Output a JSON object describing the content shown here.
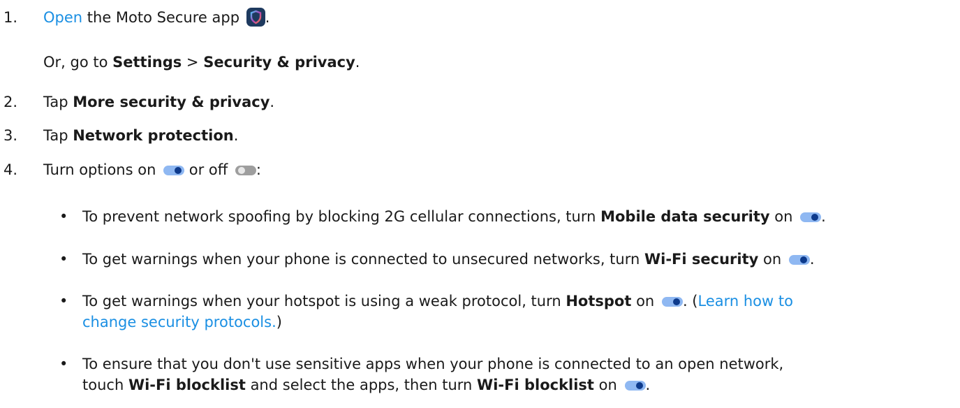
{
  "steps": [
    {
      "number": "1.",
      "link": "Open",
      "text": " the Moto Secure app",
      "end": "."
    },
    {
      "sub_pre": "Or, go to ",
      "sub_b1": "Settings",
      "sub_mid": " > ",
      "sub_b2": "Security & privacy",
      "sub_end": "."
    },
    {
      "number": "2.",
      "pre": "Tap ",
      "bold": "More security & privacy",
      "end": "."
    },
    {
      "number": "3.",
      "pre": "Tap ",
      "bold": "Network protection",
      "end": "."
    },
    {
      "number": "4.",
      "pre": "Turn options on",
      "mid": " or off",
      "end": ":"
    }
  ],
  "bullets": [
    {
      "pre": "To prevent network spoofing by blocking 2G cellular connections, turn ",
      "bold": "Mobile data security",
      "post": " on",
      "end": "."
    },
    {
      "pre": "To get warnings when your phone is connected to unsecured networks, turn ",
      "bold": "Wi-Fi security",
      "post": " on",
      "end": "."
    },
    {
      "pre": "To get warnings when your hotspot is using a weak protocol, turn ",
      "bold": "Hotspot",
      "post": " on",
      "after": ". (",
      "link_line1": "Learn how to",
      "link_line2": "change security protocols.",
      "close": ")"
    },
    {
      "line1": "To ensure that you don't use sensitive apps when your phone is connected to an open network,",
      "pre": "touch ",
      "bold1": "Wi-Fi blocklist",
      "mid": " and select the apps, then turn ",
      "bold2": "Wi-Fi blocklist",
      "post": " on",
      "end": "."
    }
  ],
  "bullet_char": "•",
  "icons": {
    "app": "moto-secure-shield-icon",
    "toggle_on": "toggle-on-icon",
    "toggle_off": "toggle-off-icon"
  },
  "colors": {
    "link": "#1a8fe3",
    "toggle_on_track": "#8fb8f2",
    "toggle_on_knob": "#0d3a8c",
    "toggle_off_track": "#9e9e9e"
  }
}
